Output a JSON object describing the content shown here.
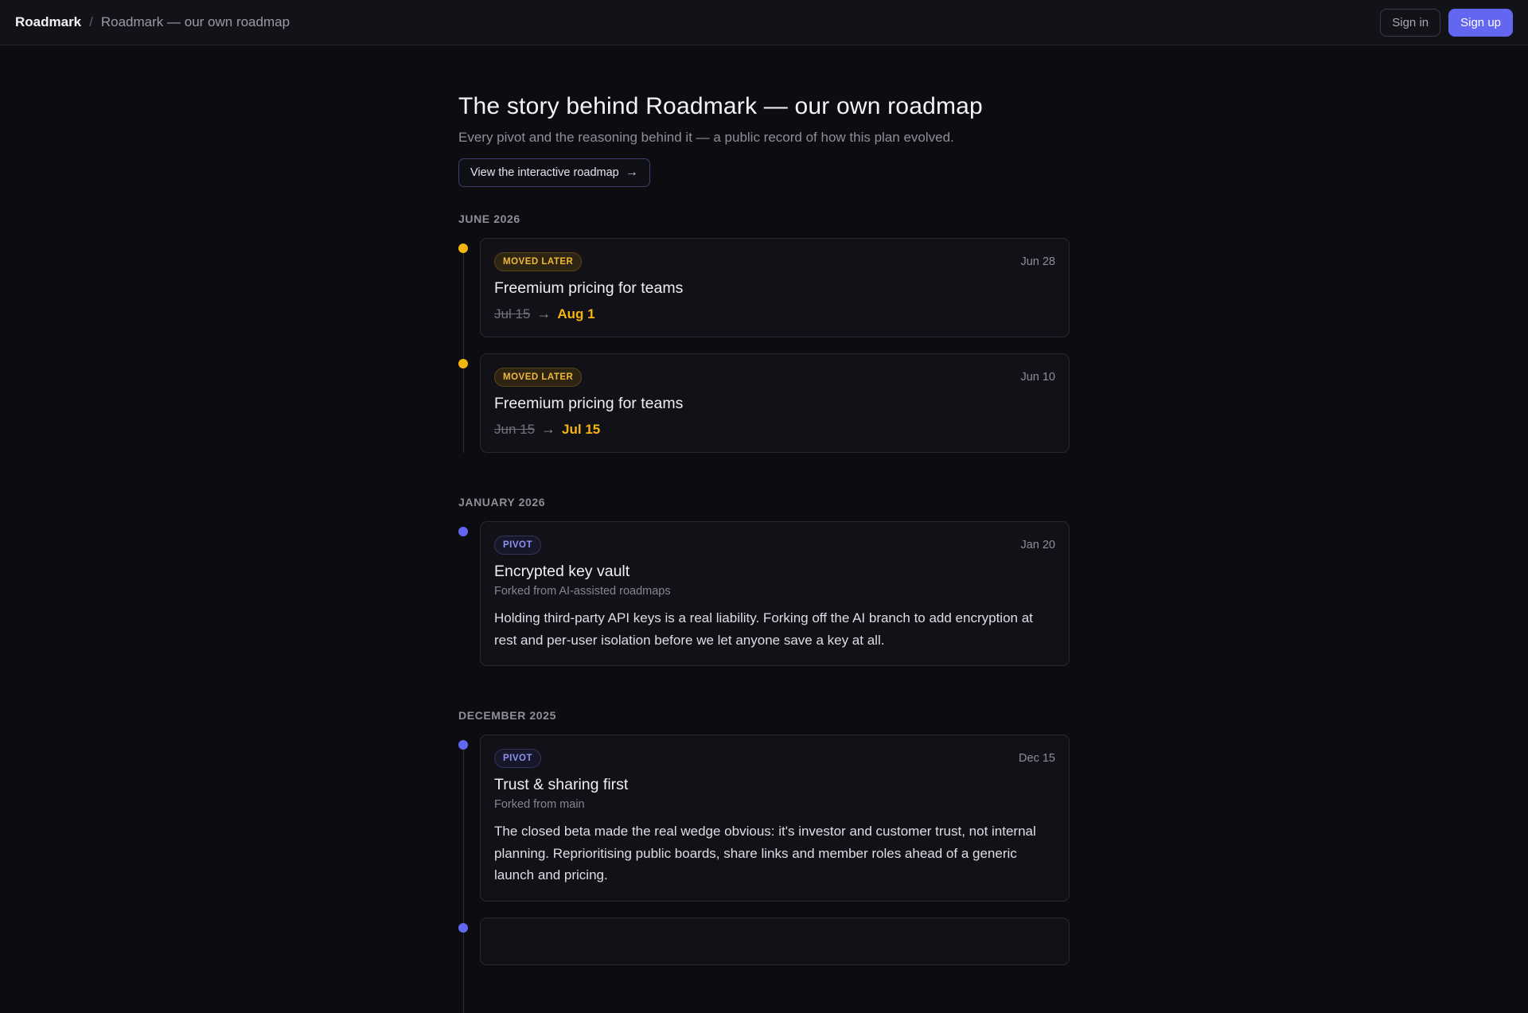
{
  "topbar": {
    "brand": "Roadmark",
    "separator": "/",
    "crumb": "Roadmark — our own roadmap",
    "sign_in": "Sign in",
    "sign_up": "Sign up"
  },
  "header": {
    "title": "The story behind Roadmark — our own roadmap",
    "subtitle": "Every pivot and the reasoning behind it — a public record of how this plan evolved.",
    "view_button": "View the interactive roadmap",
    "view_arrow": "→"
  },
  "sections": [
    {
      "label": "JUNE 2026",
      "entries": [
        {
          "badge": "MOVED LATER",
          "date": "Jun 28",
          "title": "Freemium pricing for teams",
          "old_date": "Jul 15",
          "arrow": "→",
          "new_date": "Aug 1"
        },
        {
          "badge": "MOVED LATER",
          "date": "Jun 10",
          "title": "Freemium pricing for teams",
          "old_date": "Jun 15",
          "arrow": "→",
          "new_date": "Jul 15"
        }
      ]
    },
    {
      "label": "JANUARY 2026",
      "entries": [
        {
          "badge": "PIVOT",
          "date": "Jan 20",
          "title": "Encrypted key vault",
          "meta": "Forked from AI-assisted roadmaps",
          "body": "Holding third-party API keys is a real liability. Forking off the AI branch to add encryption at rest and per-user isolation before we let anyone save a key at all."
        }
      ]
    },
    {
      "label": "DECEMBER 2025",
      "entries": [
        {
          "badge": "PIVOT",
          "date": "Dec 15",
          "title": "Trust & sharing first",
          "meta": "Forked from main",
          "body": "The closed beta made the real wedge obvious: it's investor and customer trust, not internal planning. Reprioritising public boards, share links and member roles ahead of a generic launch and pricing."
        }
      ]
    }
  ],
  "colors": {
    "accent": "#6366f1",
    "moved_later": "#f5b50f",
    "background": "#0c0c11"
  }
}
